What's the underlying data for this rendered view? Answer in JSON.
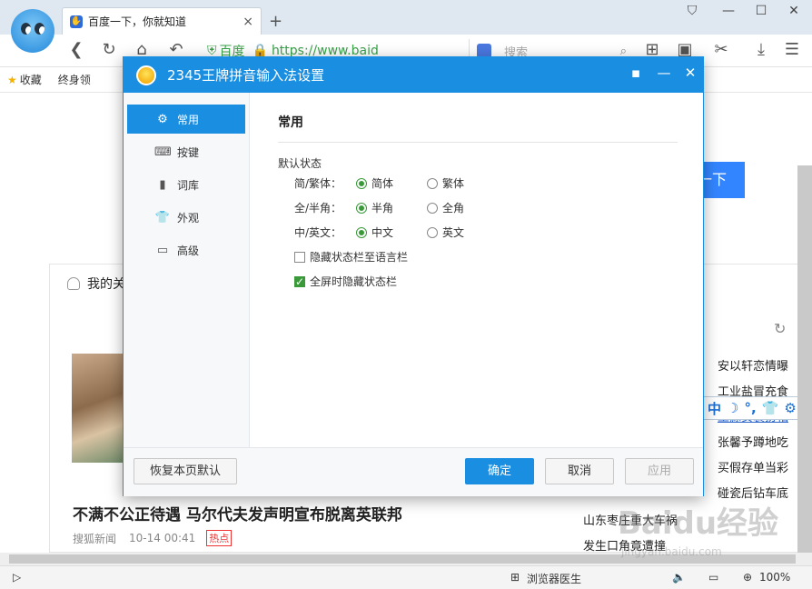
{
  "browser": {
    "tab_title": "百度一下，你就知道",
    "tab_close": "×",
    "new_tab": "+",
    "address": {
      "site_name": "百度",
      "url": "https://www.baid"
    },
    "search_placeholder": "搜索",
    "bookmarks": [
      "收藏",
      "终身领"
    ]
  },
  "page": {
    "search_button": "一下",
    "feed_header": "我的关",
    "headline": "不满不公正待遇 马尔代夫发声明宣布脱离英联邦",
    "source": "搜狐新闻",
    "time": "10-14 00:41",
    "hot_tag": "热点",
    "hot_items": [
      "安以轩恋情曝",
      "工业盐冒充食",
      "王源安装扮相",
      "张馨予蹲地吃",
      "买假存单当彩",
      "碰瓷后钻车底"
    ],
    "hot_items_left": [
      "山东枣庄重大车祸",
      "发生口角竟遭撞"
    ]
  },
  "ime_bar": {
    "lang": "中",
    "moon": "☽",
    "punct": "°,",
    "shirt": "👕",
    "gear": "⚙"
  },
  "status": {
    "doctor": "浏览器医生",
    "zoom": "100%"
  },
  "dialog": {
    "title": "2345王牌拼音输入法设置",
    "sidebar": [
      {
        "label": "常用",
        "icon": "⚙",
        "active": true
      },
      {
        "label": "按键",
        "icon": "⌨"
      },
      {
        "label": "词库",
        "icon": "▮"
      },
      {
        "label": "外观",
        "icon": "👕"
      },
      {
        "label": "高级",
        "icon": "▭"
      }
    ],
    "section_title": "常用",
    "group_title": "默认状态",
    "options": [
      {
        "label": "简/繁体：",
        "a": "简体",
        "b": "繁体"
      },
      {
        "label": "全/半角：",
        "a": "半角",
        "b": "全角"
      },
      {
        "label": "中/英文：",
        "a": "中文",
        "b": "英文"
      }
    ],
    "check1": "隐藏状态栏至语言栏",
    "check2": "全屏时隐藏状态栏",
    "buttons": {
      "restore": "恢复本页默认",
      "ok": "确定",
      "cancel": "取消",
      "apply": "应用"
    }
  },
  "watermark": {
    "main": "Baidu经验",
    "sub": "jingyan.baidu.com"
  }
}
